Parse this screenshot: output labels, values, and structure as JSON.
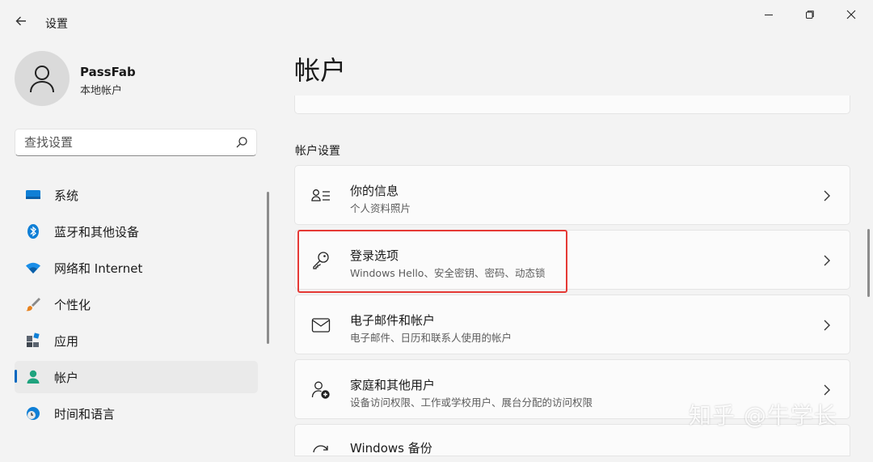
{
  "titlebar": {
    "title": "设置"
  },
  "profile": {
    "name": "PassFab",
    "account_type": "本地帐户"
  },
  "search": {
    "placeholder": "查找设置"
  },
  "nav": {
    "items": [
      {
        "label": "系统",
        "icon": "monitor-icon"
      },
      {
        "label": "蓝牙和其他设备",
        "icon": "bluetooth-icon"
      },
      {
        "label": "网络和 Internet",
        "icon": "wifi-icon"
      },
      {
        "label": "个性化",
        "icon": "brush-icon"
      },
      {
        "label": "应用",
        "icon": "apps-icon"
      },
      {
        "label": "帐户",
        "icon": "person-icon",
        "active": true
      },
      {
        "label": "时间和语言",
        "icon": "clock-globe-icon"
      }
    ]
  },
  "main": {
    "title": "帐户",
    "section_header": "帐户设置",
    "cards": [
      {
        "title": "你的信息",
        "subtitle": "个人资料照片",
        "icon": "person-info-icon"
      },
      {
        "title": "登录选项",
        "subtitle": "Windows Hello、安全密钥、密码、动态锁",
        "icon": "key-icon",
        "highlighted": true
      },
      {
        "title": "电子邮件和帐户",
        "subtitle": "电子邮件、日历和联系人使用的帐户",
        "icon": "mail-icon"
      },
      {
        "title": "家庭和其他用户",
        "subtitle": "设备访问权限、工作或学校用户、展台分配的访问权限",
        "icon": "family-add-icon"
      },
      {
        "title": "Windows 备份",
        "icon": "backup-icon"
      }
    ]
  },
  "watermark": "知乎 @牛学长",
  "colors": {
    "accent": "#0067c0",
    "highlight_border": "#e53935"
  }
}
